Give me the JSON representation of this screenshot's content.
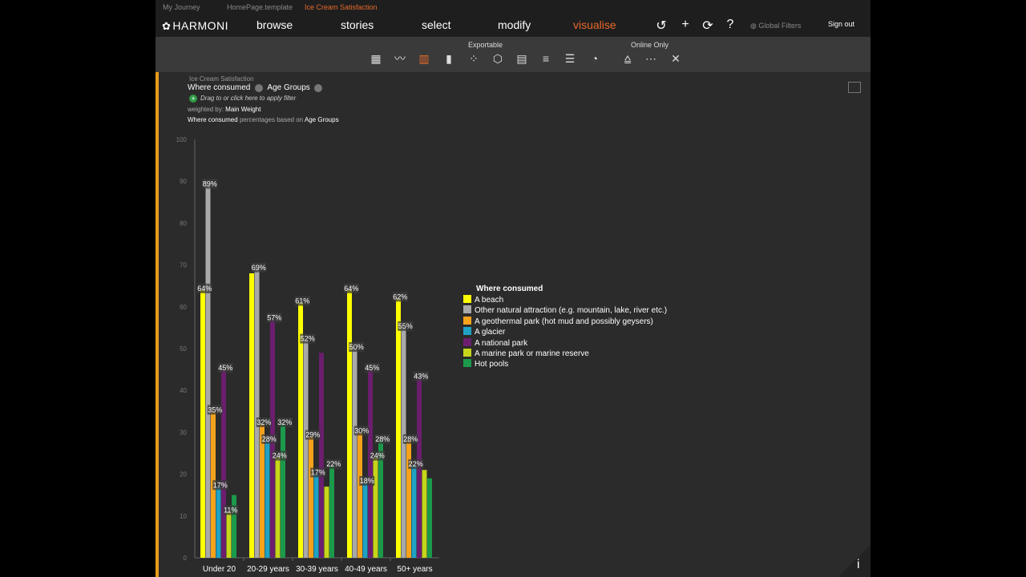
{
  "breadcrumbs": [
    "My Journey",
    "HomePage.template",
    "Ice Cream Satisfaction"
  ],
  "nav": {
    "logo": "HARMONI",
    "items": [
      "browse",
      "stories",
      "select",
      "modify",
      "visualise"
    ],
    "active": "visualise",
    "global_filters": "Global Filters",
    "sign_out": "Sign out"
  },
  "toolbar": {
    "exportable_label": "Exportable",
    "online_only_label": "Online Only"
  },
  "header": {
    "study": "Ice Cream Satisfaction",
    "row_var": "Where consumed",
    "col_var": "Age Groups",
    "filter_hint": "Drag to or click here to apply filter",
    "weighted_prefix": "weighted by:",
    "weight": "Main Weight",
    "pct_row": "Where consumed",
    "pct_mid": "percentages based on",
    "pct_col": "Age Groups"
  },
  "legend": {
    "title": "Where consumed"
  },
  "info_label": "i",
  "chart_data": {
    "type": "bar",
    "categories": [
      "Under 20",
      "20-29 years",
      "30-39 years",
      "40-49 years",
      "50+ years"
    ],
    "ylim": [
      0,
      100
    ],
    "yticks": [
      0,
      10,
      20,
      30,
      40,
      50,
      60,
      70,
      80,
      90,
      100
    ],
    "series": [
      {
        "name": "A beach",
        "color": "#ffff00",
        "values": [
          64,
          68,
          61,
          64,
          62
        ]
      },
      {
        "name": "Other natural attraction (e.g. mountain, lake, river etc.)",
        "color": "#a9a9a9",
        "values": [
          89,
          69,
          52,
          50,
          55
        ]
      },
      {
        "name": "A geothermal park (hot mud and possibly geysers)",
        "color": "#f7a21b",
        "values": [
          35,
          32,
          29,
          30,
          28
        ]
      },
      {
        "name": "A glacier",
        "color": "#1fa2c4",
        "values": [
          17,
          28,
          20,
          18,
          22
        ]
      },
      {
        "name": "A national park",
        "color": "#6b1e6e",
        "values": [
          45,
          57,
          49,
          45,
          43
        ]
      },
      {
        "name": "A marine park or marine reserve",
        "color": "#c6d61b",
        "values": [
          11,
          24,
          17,
          24,
          21
        ]
      },
      {
        "name": "Hot pools",
        "color": "#1a9a4a",
        "values": [
          15,
          32,
          22,
          28,
          19
        ]
      }
    ],
    "data_labels": {
      "Under 20": {
        "A beach": "64%",
        "Other natural attraction (e.g. mountain, lake, river etc.)": "89%",
        "A geothermal park (hot mud and possibly geysers)": "35%",
        "A glacier": "17%",
        "A national park": "45%",
        "A marine park or marine reserve": "11%"
      },
      "20-29 years": {
        "Other natural attraction (e.g. mountain, lake, river etc.)": "69%",
        "A geothermal park (hot mud and possibly geysers)": "32%",
        "A glacier": "28%",
        "A national park": "57%",
        "A marine park or marine reserve": "24%",
        "Hot pools": "32%"
      },
      "30-39 years": {
        "A beach": "61%",
        "Other natural attraction (e.g. mountain, lake, river etc.)": "52%",
        "A geothermal park (hot mud and possibly geysers)": "29%",
        "A glacier": "17%",
        "Hot pools": "22%"
      },
      "40-49 years": {
        "A beach": "64%",
        "Other natural attraction (e.g. mountain, lake, river etc.)": "50%",
        "A geothermal park (hot mud and possibly geysers)": "30%",
        "A glacier": "18%",
        "A national park": "45%",
        "A marine park or marine reserve": "24%",
        "Hot pools": "28%"
      },
      "50+ years": {
        "A beach": "62%",
        "Other natural attraction (e.g. mountain, lake, river etc.)": "55%",
        "A geothermal park (hot mud and possibly geysers)": "28%",
        "A glacier": "22%",
        "A national park": "43%"
      }
    }
  }
}
